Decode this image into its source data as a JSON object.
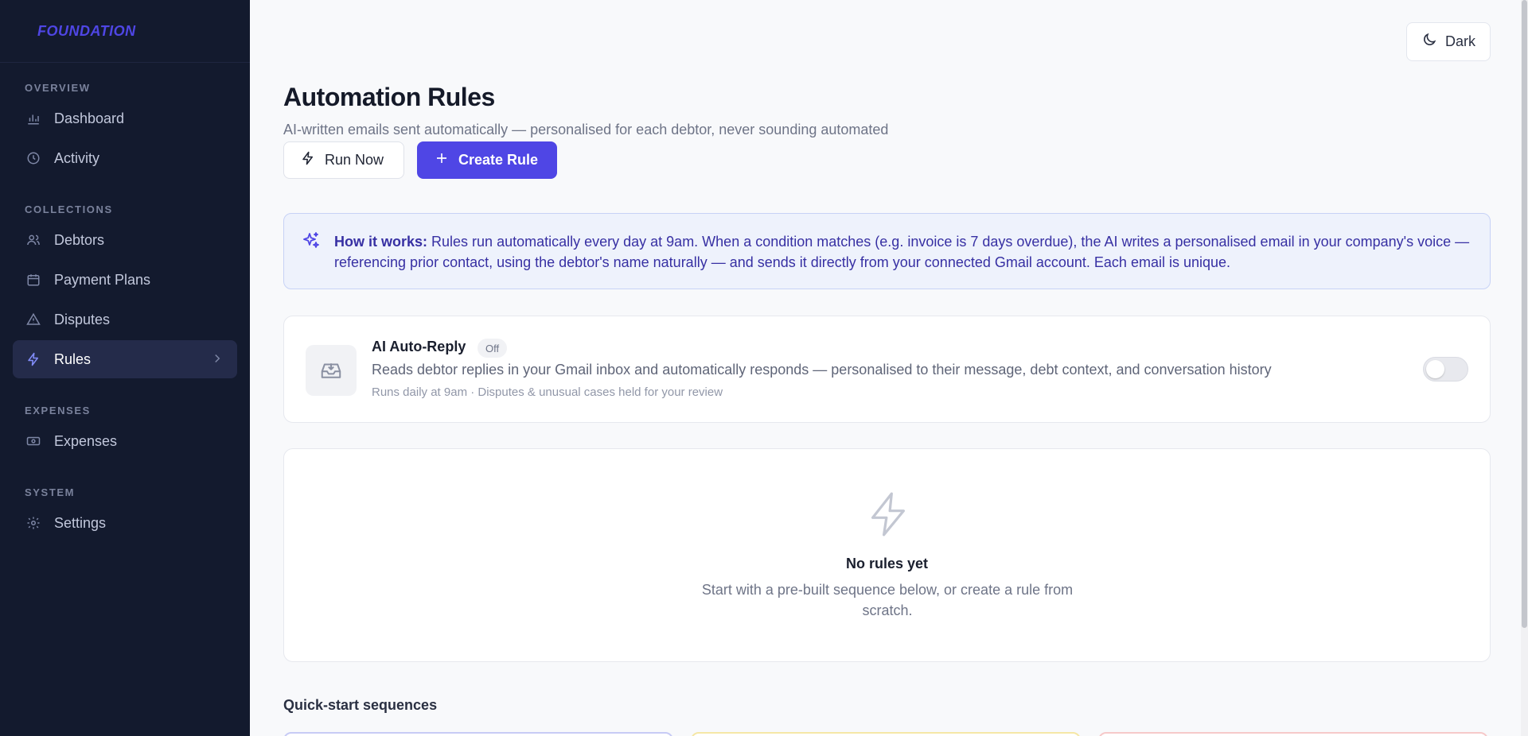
{
  "app": {
    "logo": "FOUNDATION"
  },
  "sidebar": {
    "sections": [
      {
        "label": "OVERVIEW"
      },
      {
        "label": "COLLECTIONS"
      },
      {
        "label": "EXPENSES"
      },
      {
        "label": "SYSTEM"
      }
    ],
    "items": [
      {
        "label": "Dashboard",
        "icon": "bar-chart-icon"
      },
      {
        "label": "Activity",
        "icon": "clock-icon"
      },
      {
        "label": "Debtors",
        "icon": "users-icon"
      },
      {
        "label": "Payment Plans",
        "icon": "calendar-icon"
      },
      {
        "label": "Disputes",
        "icon": "alert-triangle-icon"
      },
      {
        "label": "Rules",
        "icon": "zap-icon",
        "active": true
      },
      {
        "label": "Expenses",
        "icon": "banknote-icon"
      },
      {
        "label": "Settings",
        "icon": "gear-icon"
      }
    ]
  },
  "header": {
    "theme_toggle_label": "Dark"
  },
  "page": {
    "title": "Automation Rules",
    "subtitle": "AI-written emails sent automatically — personalised for each debtor, never sounding automated",
    "run_now_label": "Run Now",
    "create_rule_label": "Create Rule"
  },
  "info": {
    "heading": "How it works:",
    "body": "Rules run automatically every day at 9am. When a condition matches (e.g. invoice is 7 days overdue), the AI writes a personalised email in your company's voice — referencing prior contact, using the debtor's name naturally — and sends it directly from your connected Gmail account. Each email is unique."
  },
  "auto_reply": {
    "title": "AI Auto-Reply",
    "status": "Off",
    "description": "Reads debtor replies in your Gmail inbox and automatically responds — personalised to their message, debt context, and conversation history",
    "schedule": "Runs daily at 9am · Disputes & unusual cases held for your review",
    "enabled": false
  },
  "empty_state": {
    "title": "No rules yet",
    "description": "Start with a pre-built sequence below, or create a rule from scratch."
  },
  "quick_start": {
    "label": "Quick-start sequences"
  },
  "colors": {
    "accent": "#4f46e5",
    "sidebar_bg": "#131a2e",
    "info_bg": "#eef2fc"
  }
}
